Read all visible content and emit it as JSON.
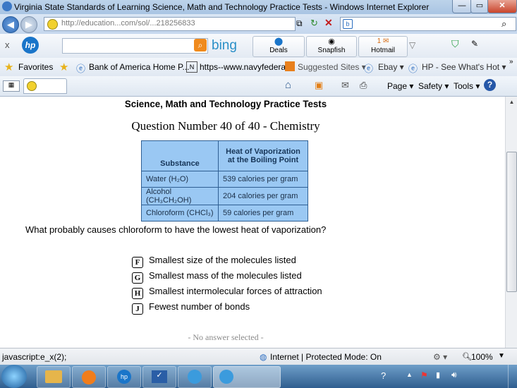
{
  "window": {
    "title": "Virginia State Standards of Learning Science, Math and Technology Practice Tests - Windows Internet Explorer",
    "controls": {
      "minimize": "—",
      "maximize": "▭",
      "close": "✕"
    }
  },
  "address_bar": {
    "url": "http://education...com/sol/...218256833",
    "search_placeholder": ""
  },
  "hp_toolbar": {
    "close": "x",
    "bing": "bing",
    "buttons": [
      {
        "label": "Deals"
      },
      {
        "label": "Snapfish"
      },
      {
        "label": "Hotmail"
      }
    ],
    "hotmail_badge": "1"
  },
  "favorites_bar": {
    "favorites_label": "Favorites",
    "items": [
      {
        "label": "Bank of America Home P..."
      },
      {
        "label": "https--www.navyfederal"
      },
      {
        "label": "Suggested Sites ▾"
      },
      {
        "label": "Ebay ▾"
      },
      {
        "label": "HP - See What's Hot ▾"
      }
    ]
  },
  "command_bar": {
    "page": "Page ▾",
    "safety": "Safety ▾",
    "tools": "Tools ▾",
    "help": "?"
  },
  "page": {
    "site_title": "Science, Math and Technology Practice Tests",
    "question_number": "Question Number 40 of 40 - Chemistry",
    "table": {
      "headers": [
        "Substance",
        "Heat of Vaporization at the Boiling Point"
      ],
      "rows": [
        [
          "Water (H₂O)",
          "539 calories per gram"
        ],
        [
          "Alcohol (CH₃CH₂OH)",
          "204 calories per gram"
        ],
        [
          "Chloroform (CHCl₃)",
          "59 calories per gram"
        ]
      ]
    },
    "question": "What probably causes chloroform to have the lowest heat of vaporization?",
    "options": [
      {
        "letter": "F",
        "text": "Smallest size of the molecules listed"
      },
      {
        "letter": "G",
        "text": "Smallest mass of the molecules listed"
      },
      {
        "letter": "H",
        "text": "Smallest intermolecular forces of attraction"
      },
      {
        "letter": "J",
        "text": "Fewest number of bonds"
      }
    ],
    "answer_status": "- No answer selected -"
  },
  "status_bar": {
    "link": "javascript:e_x(2);",
    "zone": "Internet | Protected Mode: On",
    "zoom": "100%"
  },
  "taskbar": {
    "clock": ""
  },
  "colors": {
    "table_bg": "#9ac8f3",
    "table_border": "#2f5f93"
  }
}
